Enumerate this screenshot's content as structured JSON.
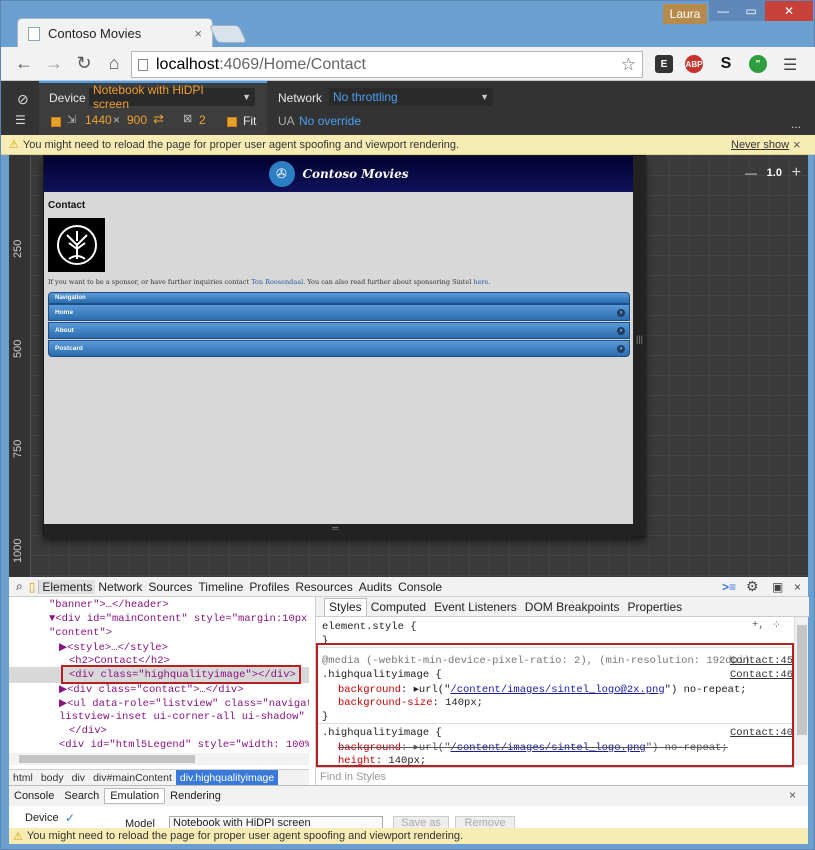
{
  "window": {
    "user": "Laura",
    "tab_title": "Contoso Movies",
    "tab_close": "×",
    "minimize": "—",
    "maximize": "▭",
    "close": "✕"
  },
  "toolbar": {
    "url_host": "localhost",
    "url_path": ":4069/Home/Contact",
    "ext_abp": "ABP"
  },
  "emulation": {
    "device_label": "Device",
    "device_value": "Notebook with HiDPI screen",
    "width": "1440",
    "times": "×",
    "height": "900",
    "scale": "2",
    "fit_label": "Fit",
    "network_label": "Network",
    "network_value": "No throttling",
    "ua_label": "UA",
    "ua_value": "No override",
    "more": "..."
  },
  "warning": {
    "text": "You might need to reload the page for proper user agent spoofing and viewport rendering.",
    "never_show": "Never show",
    "close": "×"
  },
  "viewport": {
    "zoom_value": "1.0",
    "zoom_minus": "—",
    "zoom_plus": "+",
    "ruler_ticks": [
      "250",
      "500",
      "750",
      "1000"
    ]
  },
  "site": {
    "name": "Contoso Movies",
    "heading": "Contact",
    "sponsor_pre": "If you want to be a sponsor, or have further inquiries contact ",
    "sponsor_link": "Ton Roosendaal",
    "sponsor_mid": ". You can also read further about sponsoring Sintel ",
    "sponsor_here": "here",
    "sponsor_end": ".",
    "nav_header": "Navigation",
    "nav_items": [
      "Home",
      "About",
      "Postcard"
    ]
  },
  "devtools": {
    "tabs": [
      "Elements",
      "Network",
      "Sources",
      "Timeline",
      "Profiles",
      "Resources",
      "Audits",
      "Console"
    ],
    "breadcrumbs": [
      "html",
      "body",
      "div",
      "div#mainContent",
      "div.highqualityimage"
    ],
    "sidebar_tabs": [
      "Styles",
      "Computed",
      "Event Listeners",
      "DOM Breakpoints",
      "Properties"
    ],
    "find_placeholder": "Find in Styles",
    "drawer_tabs": [
      "Console",
      "Search",
      "Emulation",
      "Rendering"
    ],
    "drawer_device": "Device",
    "drawer_model_label": "Model",
    "drawer_model_value": "Notebook with HiDPI screen",
    "save_as": "Save as",
    "remove": "Remove"
  },
  "dom_lines": [
    {
      "t": "\"banner\">…</header>"
    },
    {
      "t": "▼<div id=\"mainContent\" style=\"margin:10px;"
    },
    {
      "t": "\"content\">"
    },
    {
      "t": "▶<style>…</style>"
    },
    {
      "t": "<h2>Contact</h2>"
    },
    {
      "t": "<div class=\"highqualityimage\"></div>"
    },
    {
      "t": "▶<div class=\"contact\">…</div>"
    },
    {
      "t": "▶<ul data-role=\"listview\" class=\"navigat"
    },
    {
      "t": "listview-inset ui-corner-all ui-shadow\" c"
    },
    {
      "t": "</div>"
    },
    {
      "t": "<div id=\"html5Legend\" style=\"width: 100%;"
    }
  ],
  "styles": {
    "element_style": "element.style {",
    "close_brace": "}",
    "media": "@media (-webkit-min-device-pixel-ratio: 2), (min-resolution: 192dpi)",
    "media_link": "Contact:45",
    "sel1": ".highqualityimage {",
    "sel1_link": "Contact:46",
    "bg_prop": "background",
    "bg1_url": "/content/images/sintel_logo@2x.png",
    "bg_norepeat": "no-repeat;",
    "bgsize_prop": "background-size",
    "bgsize_val": "140px;",
    "sel2": ".highqualityimage {",
    "sel2_link": "Contact:40",
    "bg2_url": "/content/images/sintel_logo.png",
    "height_prop": "height",
    "height_val": "140px;"
  }
}
